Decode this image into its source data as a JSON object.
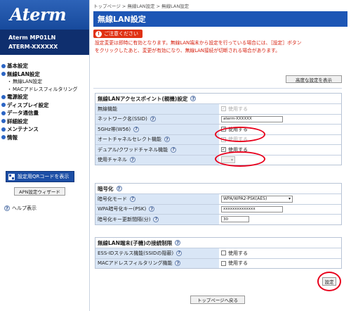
{
  "sidebar": {
    "logo": "Aterm",
    "model_line1": "Aterm   MP01LN",
    "model_line2": "ATERM-XXXXXX",
    "nav": [
      {
        "type": "item",
        "label": "基本設定"
      },
      {
        "type": "item",
        "label": "無線LAN設定"
      },
      {
        "type": "sub",
        "label": "無線LAN設定"
      },
      {
        "type": "sub",
        "label": "MACアドレスフィルタリング"
      },
      {
        "type": "item",
        "label": "電源設定"
      },
      {
        "type": "item",
        "label": "ディスプレイ設定"
      },
      {
        "type": "item",
        "label": "データ通信量"
      },
      {
        "type": "item",
        "label": "詳細設定"
      },
      {
        "type": "item",
        "label": "メンテナンス"
      },
      {
        "type": "item",
        "label": "情報"
      }
    ],
    "qr_button": "設定用QRコードを表示",
    "apn_button": "APN設定ウィザード",
    "help": "ヘルプ表示"
  },
  "main": {
    "breadcrumb": "トップページ > 無線LAN設定 > 無線LAN設定",
    "title": "無線LAN設定",
    "warning_badge": "ご注意ください",
    "warning_line1": "設定変更は即時に有効となります。無線LAN端末から設定を行っている場合には、［設定］ボタン",
    "warning_line2": "をクリックしたあと、変更が有効になり、無線LAN接続が切断される場合があります。",
    "advanced_button": "高度な設定を表示",
    "section1": {
      "title": "無線LANアクセスポイント(親機)設定",
      "rows": {
        "wireless_func": {
          "label": "無線機能",
          "value": "使用する"
        },
        "ssid": {
          "label": "ネットワーク名(SSID)",
          "value": "aterm-XXXXXX"
        },
        "ghz5": {
          "label": "5GHz帯(W56)",
          "value": "使用する"
        },
        "auto_channel": {
          "label": "オートチャネルセレクト機能",
          "value": "使用する"
        },
        "dual_channel": {
          "label": "デュアル/クワッドチャネル機能",
          "value": "使用する"
        },
        "channel": {
          "label": "使用チャネル",
          "value": ""
        }
      }
    },
    "section2": {
      "title": "暗号化",
      "rows": {
        "enc_mode": {
          "label": "暗号化モード",
          "value": "WPA/WPA2-PSK(AES)"
        },
        "psk": {
          "label": "WPA暗号化キー(PSK)",
          "value": "xxxxxxxxxxxxxx"
        },
        "interval": {
          "label": "暗号化キー更新間隔(分)",
          "value": "30"
        }
      }
    },
    "section3": {
      "title": "無線LAN端末(子機)の接続制限",
      "rows": {
        "stealth": {
          "label": "ESS-IDステルス機能(SSIDの隠蔽)",
          "value": "使用する"
        },
        "mac_filter": {
          "label": "MACアドレスフィルタリング機能",
          "value": "使用する"
        }
      }
    },
    "set_button": "設定",
    "top_button": "トップページへ戻る"
  },
  "colors": {
    "accent": "#1d56b5",
    "sidebar_dark": "#0f2f6e",
    "label_bg": "#d9e6f6",
    "warning": "#e03214",
    "highlight_ring": "#e8001c"
  }
}
